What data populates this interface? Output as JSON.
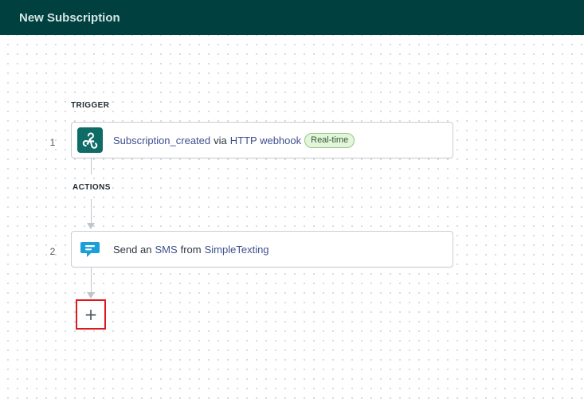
{
  "header": {
    "title": "New Subscription"
  },
  "flow": {
    "trigger_label": "TRIGGER",
    "actions_label": "ACTIONS",
    "steps": [
      {
        "number": "1",
        "icon": "webhook-icon",
        "parts": [
          "Subscription_created",
          "via",
          "HTTP webhook"
        ],
        "badge": "Real-time"
      },
      {
        "number": "2",
        "icon": "simpletexting-icon",
        "parts": [
          "Send an",
          "SMS",
          "from",
          "SimpleTexting"
        ]
      }
    ],
    "add_step_symbol": "+"
  },
  "colors": {
    "header_bg": "#00403f",
    "link": "#3e4f8f",
    "badge_bg": "#e4f5dc",
    "badge_border": "#8fca7e",
    "highlight": "#e0191f",
    "sms_brand": "#1a9fd9"
  }
}
